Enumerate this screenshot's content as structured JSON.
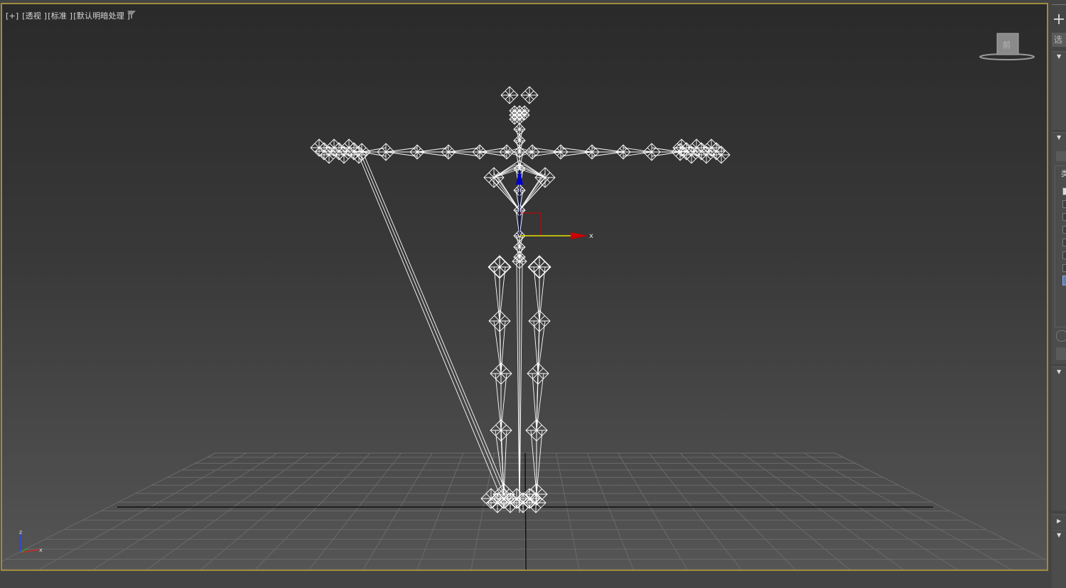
{
  "viewport": {
    "label_plus": "[+]",
    "label_view": "[透视 ]",
    "label_shading_style": "[标准 ]",
    "label_lighting": "[默认明暗处理 ]",
    "axis_label": "x",
    "tripod": {
      "z": "z",
      "x": "x"
    },
    "viewcube_face": "前",
    "colors": {
      "border": "#a08c3c",
      "wire": "#ffffff",
      "x_axis": "#cc0000",
      "y_axis": "#e8e000",
      "z_axis": "#0000cc"
    }
  },
  "right_panel": {
    "add_icon": "plus-icon",
    "select_text": "选",
    "category_label": "类"
  }
}
